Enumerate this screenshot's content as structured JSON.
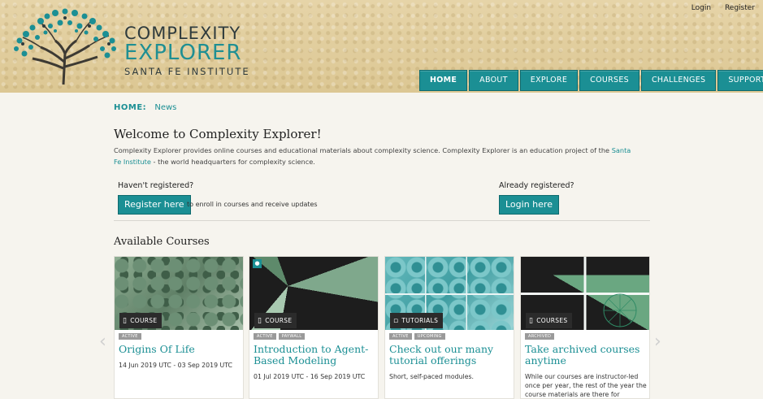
{
  "header": {
    "logo": {
      "line1": "COMPLEXITY",
      "line2": "EXPLORER",
      "line3": "SANTA FE INSTITUTE"
    },
    "auth": {
      "login": "Login",
      "register": "Register"
    },
    "nav": [
      "HOME",
      "ABOUT",
      "EXPLORE",
      "COURSES",
      "CHALLENGES",
      "SUPPORT"
    ],
    "active_nav": "HOME"
  },
  "breadcrumb": {
    "home": "HOME:",
    "current": "News"
  },
  "welcome": {
    "title": "Welcome to Complexity Explorer!",
    "desc_1": "Complexity Explorer provides online courses and educational materials about complexity science.  Complexity Explorer is an education project of the",
    "desc_link": "Santa Fe Institute",
    "desc_2": "- the world headquarters for complexity science."
  },
  "register": {
    "label": "Haven't registered?",
    "button": "Register here",
    "note": "to enroll in courses and receive updates"
  },
  "login": {
    "label": "Already registered?",
    "button": "Login here"
  },
  "courses": {
    "title": "Available Courses",
    "items": [
      {
        "tag": "COURSE",
        "badges": [
          "ACTIVE"
        ],
        "title": "Origins Of Life",
        "sub": "14 Jun 2019 UTC - 03 Sep 2019 UTC"
      },
      {
        "tag": "COURSE",
        "badges": [
          "ACTIVE",
          "PAYWALL"
        ],
        "title": "Introduction to Agent-Based Modeling",
        "sub": "01 Jul 2019 UTC - 16 Sep 2019 UTC"
      },
      {
        "tag": "TUTORIALS",
        "badges": [
          "ACTIVE",
          "UPCOMING"
        ],
        "title": "Check out our many tutorial offerings",
        "sub": "Short, self-paced modules."
      },
      {
        "tag": "COURSES",
        "badges": [
          "ARCHIVED"
        ],
        "title": "Take archived courses anytime",
        "sub": "While our courses are instructor-led once per year, the rest of the year the course materials are there for"
      }
    ]
  },
  "colors": {
    "accent": "#1b8f94",
    "header_bg": "#e6d4a8",
    "tag_bg": "#2b2b2b"
  }
}
